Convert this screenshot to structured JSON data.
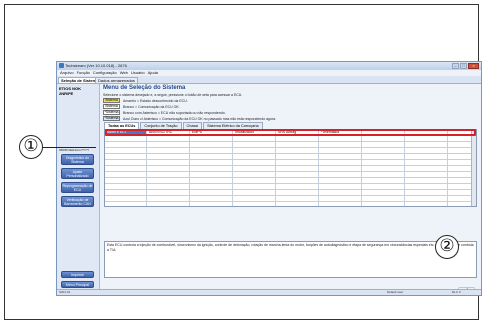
{
  "window": {
    "title": "Techstream (Ver 10.10.018) - 2676",
    "controls": [
      "–",
      "□",
      "×"
    ]
  },
  "menubar": [
    "Arquivo",
    "Função",
    "Configuração",
    "Web",
    "Usuário",
    "Ajuda"
  ],
  "tabs": [
    {
      "label": "Seleção de Sistema",
      "active": true
    },
    {
      "label": "Dados armazenados",
      "active": false
    }
  ],
  "sidebar": {
    "vehicle_line1": "ETIOS NGK",
    "vehicle_line2": "2NR/FE",
    "vin": "9BRBV3EE3GG?????",
    "buttons": [
      "Diagnóstico do Sistema",
      "Ajuste Personalizado",
      "Reprogramação de ECU",
      "Verificação de Barramento CAN"
    ],
    "bottom_buttons": [
      "Imprimir",
      "Menu Principal"
    ]
  },
  "main": {
    "heading": "Menu de Seleção do Sistema",
    "instruction": "Selecione o sistema desejado e, a seguir, pressione o botão de seta para acessar a ECU.",
    "legend": [
      {
        "box": "Sistema",
        "text": "Amarelo = Estado desconhecido da ECU.",
        "color": "#f4e04d"
      },
      {
        "box": "Sistema",
        "text": "Branco = Comunicação da ECU OK.",
        "color": "#ffffff"
      },
      {
        "box": "*Sistema",
        "text": "Branco com Asterisco = ECU não suportada ou não respondendo.",
        "color": "#ffffff"
      },
      {
        "box": "*Sistema",
        "text": "Azul Claro c/ Asterisco = Comunicação da ECU OK no passado mas não está respondendo agora.",
        "color": "#cfe6fb"
      }
    ],
    "system_tabs": [
      {
        "label": "Todas as ECUs",
        "active": true
      },
      {
        "label": "Conjunto de Tração",
        "active": false
      },
      {
        "label": "Chassi",
        "active": false
      },
      {
        "label": "Sistema Elétrico da Carroçaria",
        "active": false
      }
    ],
    "grid_row": [
      "Motor e ECT",
      "ABS/VSC/TRC",
      "EMPS",
      "Imobilizador",
      "SRS Airbag",
      "*Telemática"
    ],
    "description": "Esta ECU controla a injeção de combustível, sincronismo da ignição, controle de detonação, rotação de marcha-lenta do motor, funções de autodiagnóstico e etapa de segurança em circunstâncias especiais etc.. Adicionalmente  controla a T/A."
  },
  "statusbar": {
    "left": "S301-01",
    "middle": "Default user",
    "right": "DLC 3"
  },
  "callouts": {
    "one": "①",
    "two": "②"
  },
  "colors": {
    "accent": "#3f63ab",
    "selection": "#4a78c4",
    "highlight_box": "#d2232a",
    "arrow": "#3aa64a"
  }
}
